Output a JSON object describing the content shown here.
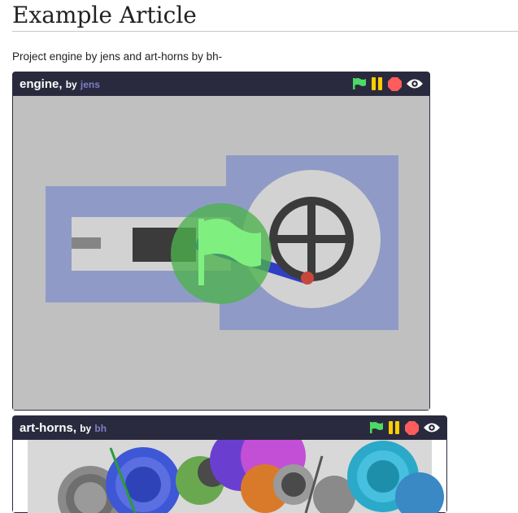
{
  "article": {
    "title": "Example Article",
    "intro": "Project engine by jens and art-horns by bh-"
  },
  "projects": [
    {
      "name": "engine,",
      "by": "by",
      "author": "jens"
    },
    {
      "name": "art-horns,",
      "by": "by",
      "author": "bh"
    }
  ],
  "controls": {
    "icons": [
      "green-flag-icon",
      "pause-icon",
      "stop-icon",
      "eye-icon"
    ],
    "colors": {
      "flag": "#4cd964",
      "pause": "#ffcc00",
      "stop": "#ff5c5c",
      "eye": "#ffffff",
      "bar": "#2a2a3e",
      "author": "#7e7ec8"
    }
  },
  "stage_overlay": {
    "icon": "green-flag-icon",
    "state": "not-started"
  }
}
